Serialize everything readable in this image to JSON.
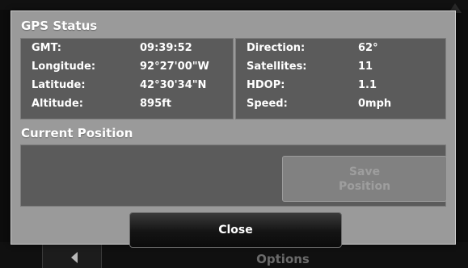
{
  "background": {
    "options_label": "Options"
  },
  "dialog": {
    "gps_title": "GPS Status",
    "position_title": "Current Position",
    "left_rows": [
      {
        "label": "GMT:",
        "value": "09:39:52"
      },
      {
        "label": "Longitude:",
        "value": "92°27'00\"W"
      },
      {
        "label": "Latitude:",
        "value": "42°30'34\"N"
      },
      {
        "label": "Altitude:",
        "value": "895ft"
      }
    ],
    "right_rows": [
      {
        "label": "Direction:",
        "value": "62°"
      },
      {
        "label": "Satellites:",
        "value": "11"
      },
      {
        "label": "HDOP:",
        "value": "1.1"
      },
      {
        "label": "Speed:",
        "value": "0mph"
      }
    ],
    "save_label_line1": "Save",
    "save_label_line2": "Position",
    "close_label": "Close"
  },
  "colors": {
    "dialog_bg": "#9a9a9a",
    "panel_bg": "#5b5b5b",
    "text": "#ffffff",
    "disabled_text": "#9e9e9e"
  }
}
